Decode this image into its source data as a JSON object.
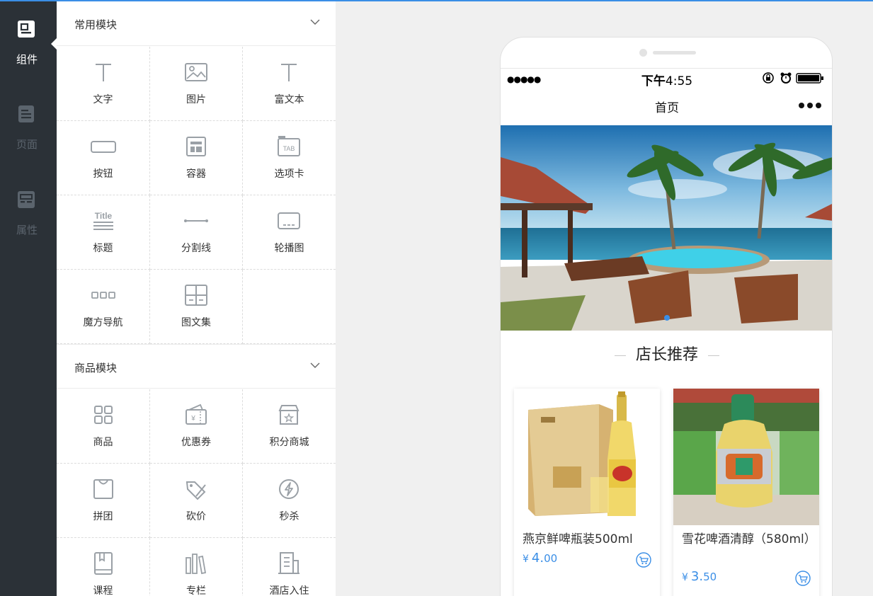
{
  "nav": {
    "items": [
      {
        "label": "组件",
        "icon": "component-icon",
        "active": true
      },
      {
        "label": "页面",
        "icon": "page-icon",
        "active": false
      },
      {
        "label": "属性",
        "icon": "property-icon",
        "active": false
      }
    ]
  },
  "panel": {
    "sections": [
      {
        "title": "常用模块",
        "items": [
          {
            "label": "文字",
            "icon": "text-icon"
          },
          {
            "label": "图片",
            "icon": "image-icon"
          },
          {
            "label": "富文本",
            "icon": "rich-text-icon"
          },
          {
            "label": "按钮",
            "icon": "button-icon"
          },
          {
            "label": "容器",
            "icon": "container-icon"
          },
          {
            "label": "选项卡",
            "icon": "tab-icon",
            "glyph": "TAB"
          },
          {
            "label": "标题",
            "icon": "title-icon",
            "glyph": "Title"
          },
          {
            "label": "分割线",
            "icon": "divider-icon"
          },
          {
            "label": "轮播图",
            "icon": "carousel-icon"
          },
          {
            "label": "魔方导航",
            "icon": "cube-nav-icon"
          },
          {
            "label": "图文集",
            "icon": "image-text-icon"
          }
        ]
      },
      {
        "title": "商品模块",
        "items": [
          {
            "label": "商品",
            "icon": "goods-icon"
          },
          {
            "label": "优惠券",
            "icon": "coupon-icon",
            "glyph": "¥"
          },
          {
            "label": "积分商城",
            "icon": "points-mall-icon"
          },
          {
            "label": "拼团",
            "icon": "group-buy-icon"
          },
          {
            "label": "砍价",
            "icon": "bargain-icon"
          },
          {
            "label": "秒杀",
            "icon": "flash-sale-icon"
          },
          {
            "label": "课程",
            "icon": "course-icon"
          },
          {
            "label": "专栏",
            "icon": "column-icon"
          },
          {
            "label": "酒店入住",
            "icon": "hotel-icon"
          }
        ]
      }
    ]
  },
  "phone": {
    "status": {
      "signal": "●●●●●",
      "time_prefix": "下午",
      "time": "4:55"
    },
    "nav_title": "首页",
    "section_title": "店长推荐",
    "products": [
      {
        "name": "燕京鲜啤瓶装500ml",
        "currency": "¥",
        "price_int": "4.",
        "price_dec": "00"
      },
      {
        "name": "雪花啤酒清醇（580ml）",
        "currency": "¥",
        "price_int": "3.",
        "price_dec": "50"
      }
    ]
  },
  "colors": {
    "accent": "#3a8ee6",
    "nav_bg": "#2b3137",
    "icon_gray": "#9aa0a6"
  }
}
